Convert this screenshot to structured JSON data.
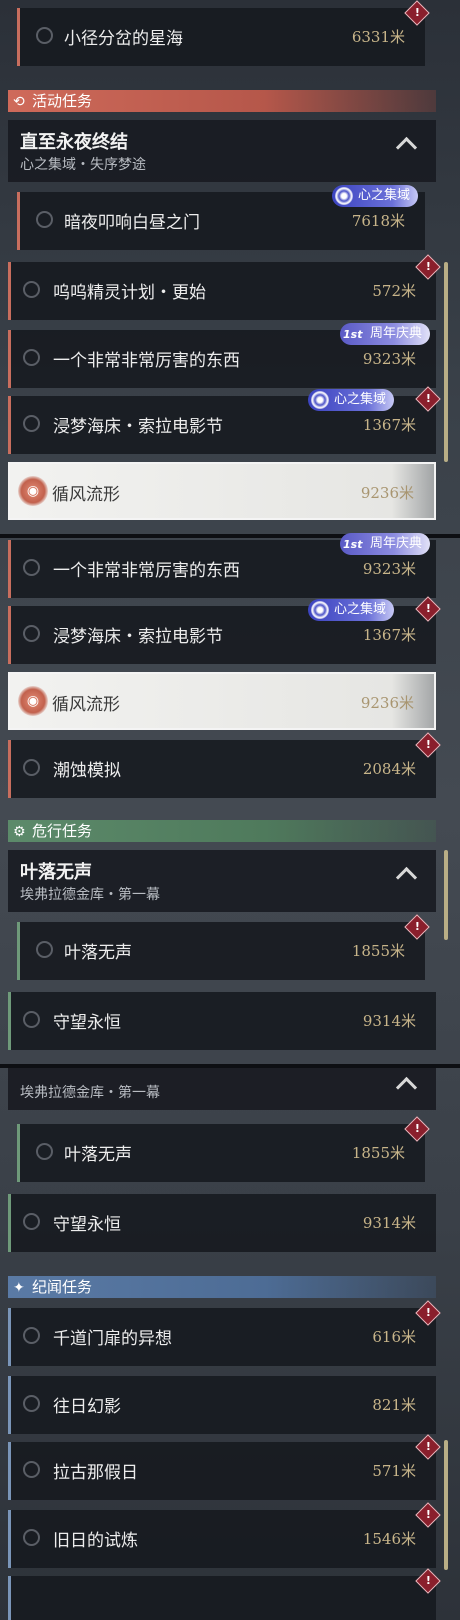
{
  "sections": {
    "activity": "活动任务",
    "danger": "危行任务",
    "chronicle": "纪闻任务"
  },
  "groups": {
    "activity": {
      "title": "直至永夜终结",
      "subtitle": "心之集域・失序梦途"
    },
    "danger": {
      "title": "叶落无声",
      "subtitle": "埃弗拉德金库・第一幕"
    },
    "danger_repeat": {
      "subtitle": "埃弗拉德金库・第一幕"
    }
  },
  "badges": {
    "heart": "心之集域",
    "anniversary": "周年庆典",
    "anniversary_tag": "1st"
  },
  "warn_glyph": "!",
  "items": [
    {
      "name": "小径分岔的星海",
      "dist": "6331米"
    },
    {
      "name": "暗夜叩响白昼之门",
      "dist": "7618米"
    },
    {
      "name": "呜呜精灵计划・更始",
      "dist": "572米"
    },
    {
      "name": "一个非常非常厉害的东西",
      "dist": "9323米"
    },
    {
      "name": "浸梦海床・索拉电影节",
      "dist": "1367米"
    },
    {
      "name": "循风流形",
      "dist": "9236米"
    },
    {
      "name": "一个非常非常厉害的东西",
      "dist": "9323米"
    },
    {
      "name": "浸梦海床・索拉电影节",
      "dist": "1367米"
    },
    {
      "name": "循风流形",
      "dist": "9236米"
    },
    {
      "name": "潮蚀模拟",
      "dist": "2084米"
    },
    {
      "name": "叶落无声",
      "dist": "1855米"
    },
    {
      "name": "守望永恒",
      "dist": "9314米"
    },
    {
      "name": "叶落无声",
      "dist": "1855米"
    },
    {
      "name": "守望永恒",
      "dist": "9314米"
    },
    {
      "name": "千道门扉的异想",
      "dist": "616米"
    },
    {
      "name": "往日幻影",
      "dist": "821米"
    },
    {
      "name": "拉古那假日",
      "dist": "571米"
    },
    {
      "name": "旧日的试炼",
      "dist": "1546米"
    }
  ]
}
